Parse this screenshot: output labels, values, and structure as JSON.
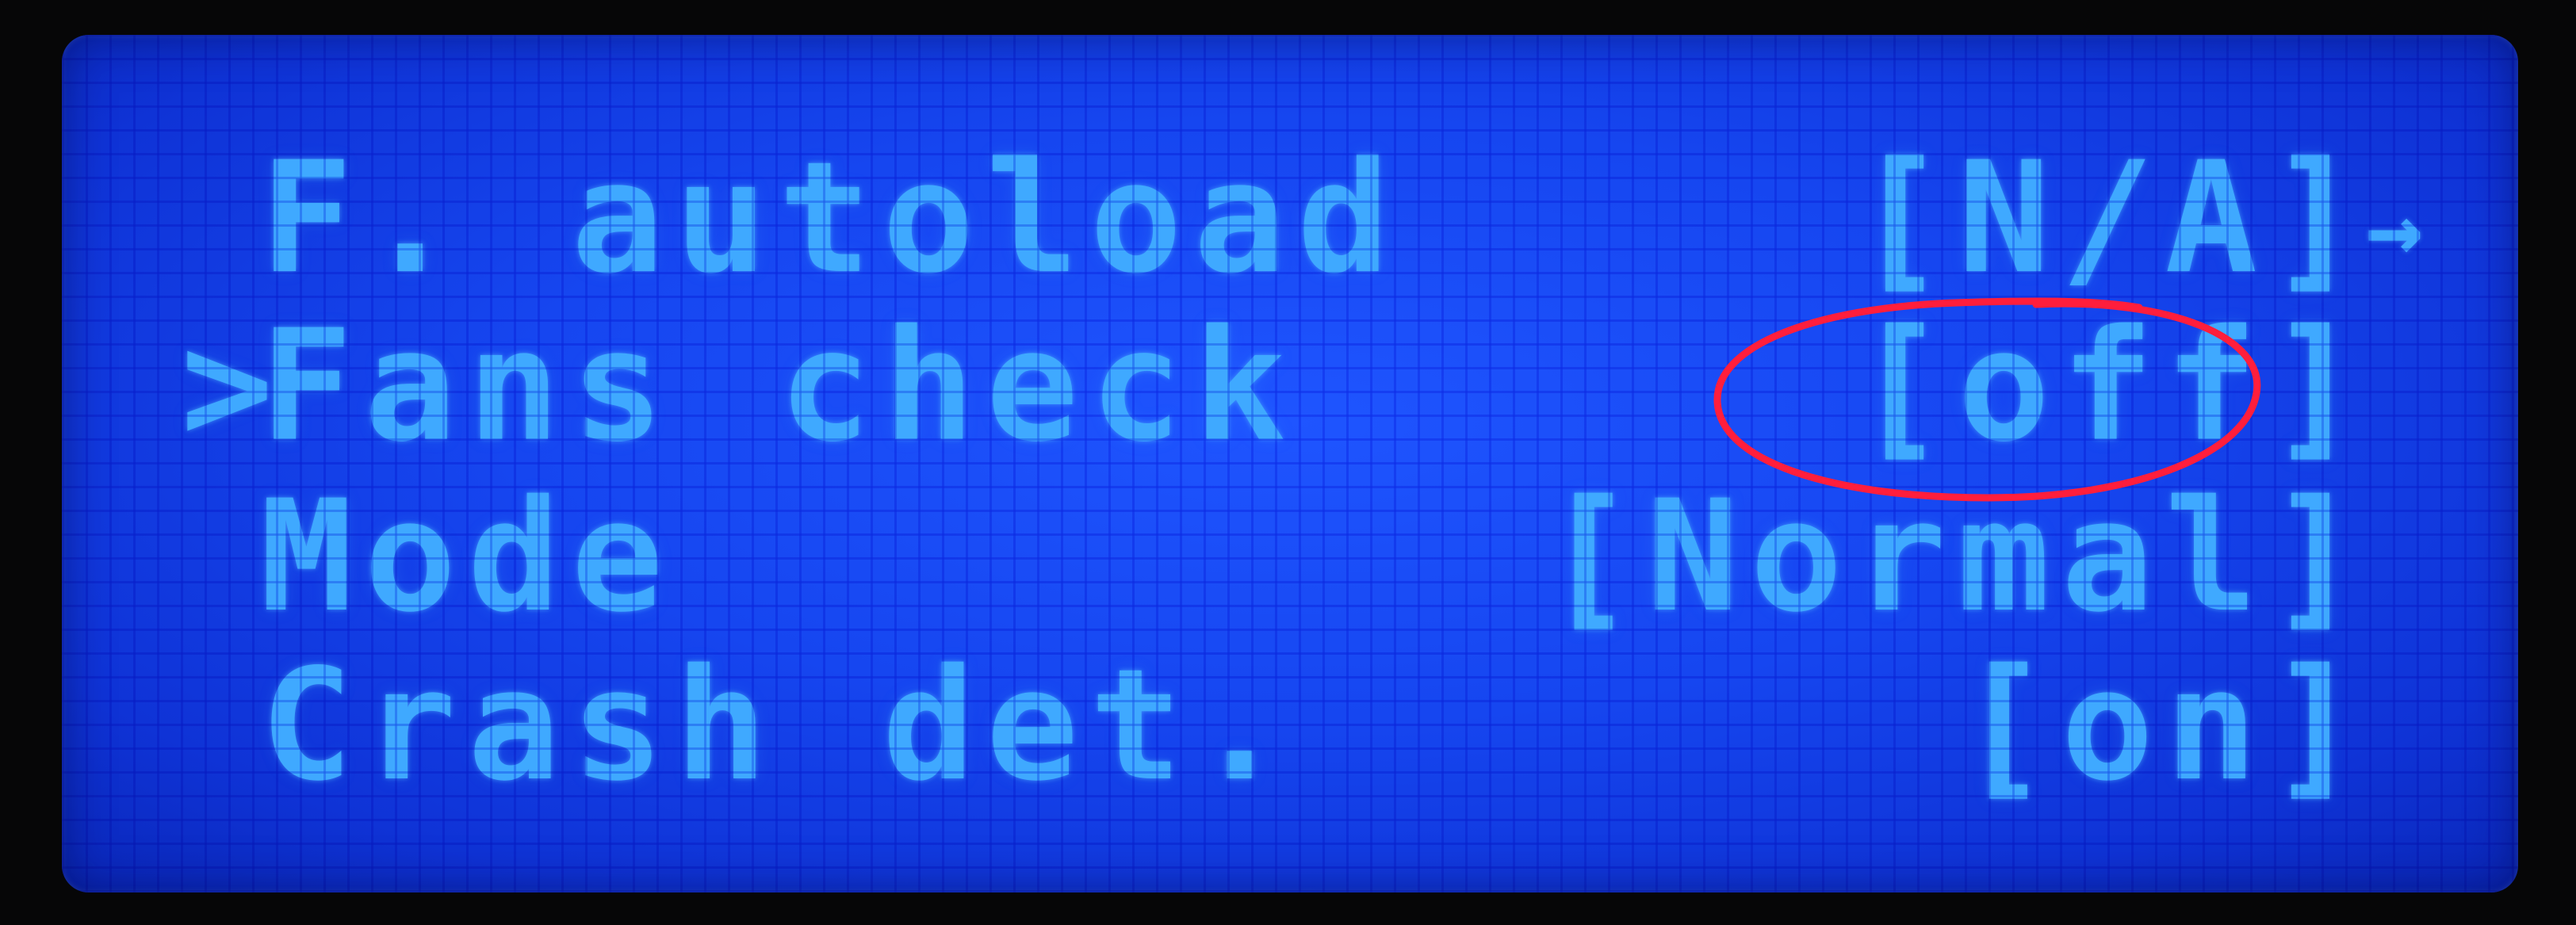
{
  "menu": {
    "rows": [
      {
        "label": "F. autoload",
        "value": "[N/A]",
        "selected": false
      },
      {
        "label": "Fans check",
        "value": "[off]",
        "selected": true
      },
      {
        "label": "Mode",
        "value": "[Normal]",
        "selected": false
      },
      {
        "label": "Crash det.",
        "value": "[on]",
        "selected": false
      }
    ],
    "cursor_glyph": ">",
    "scroll_indicator": "→"
  },
  "colors": {
    "lcd_background": "#1646f0",
    "lcd_text": "#3fa9ff",
    "annotation_circle": "#ff1e3c"
  },
  "annotation": {
    "type": "hand-drawn-ellipse",
    "target": "Fans check value"
  }
}
